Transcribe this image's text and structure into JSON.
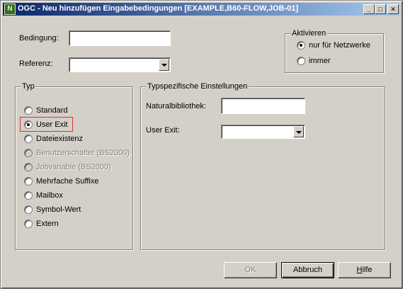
{
  "window": {
    "title": "OGC - Neu hinzufügen Eingabebedingungen [EXAMPLE,B60-FLOW,JOB-01]",
    "icon_letter": "N",
    "minimize": "_",
    "maximize": "□",
    "close": "✕"
  },
  "form": {
    "bedingung_label": "Bedingung:",
    "bedingung_value": "",
    "referenz_label": "Referenz:",
    "referenz_value": ""
  },
  "aktivieren": {
    "legend": "Aktivieren",
    "options": [
      {
        "label": "nur für Netzwerke",
        "checked": true
      },
      {
        "label": "immer",
        "checked": false
      }
    ]
  },
  "typ": {
    "legend": "Typ",
    "options": [
      {
        "label": "Standard",
        "checked": false,
        "disabled": false
      },
      {
        "label": "User Exit",
        "checked": true,
        "disabled": false
      },
      {
        "label": "Dateiexistenz",
        "checked": false,
        "disabled": false
      },
      {
        "label": "Benutzerschalter (BS2000)",
        "checked": false,
        "disabled": true
      },
      {
        "label": "Jobvariable (BS2000)",
        "checked": false,
        "disabled": true
      },
      {
        "label": "Mehrfache Suffixe",
        "checked": false,
        "disabled": false
      },
      {
        "label": "Mailbox",
        "checked": false,
        "disabled": false
      },
      {
        "label": "Symbol-Wert",
        "checked": false,
        "disabled": false
      },
      {
        "label": "Extern",
        "checked": false,
        "disabled": false
      }
    ]
  },
  "typspezifisch": {
    "legend": "Typspezifische Einstellungen",
    "naturalbibliothek_label": "Naturalbibliothek:",
    "naturalbibliothek_value": "",
    "user_exit_label": "User Exit:",
    "user_exit_value": ""
  },
  "buttons": {
    "ok": "OK",
    "abbruch": "Abbruch",
    "hilfe_hotkey": "H",
    "hilfe_rest": "ilfe"
  },
  "colors": {
    "titlebar_start": "#0a246a",
    "titlebar_end": "#a6caf0",
    "face": "#d4d0c8",
    "focus_highlight": "#e03030"
  }
}
